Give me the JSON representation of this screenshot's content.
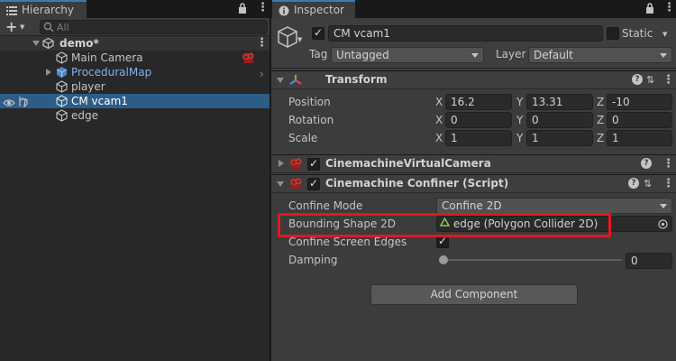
{
  "hierarchy": {
    "tab_label": "Hierarchy",
    "search_placeholder": "All",
    "scene_name": "demo*",
    "items": [
      {
        "label": "Main Camera",
        "type": "object"
      },
      {
        "label": "ProceduralMap",
        "type": "prefab"
      },
      {
        "label": "player",
        "type": "object"
      },
      {
        "label": "CM vcam1",
        "type": "object",
        "selected": true
      },
      {
        "label": "edge",
        "type": "object"
      }
    ]
  },
  "inspector": {
    "tab_label": "Inspector",
    "object": {
      "name": "CM vcam1",
      "active": true,
      "static_label": "Static",
      "tag_label": "Tag",
      "tag_value": "Untagged",
      "layer_label": "Layer",
      "layer_value": "Default"
    },
    "transform": {
      "title": "Transform",
      "rows": [
        {
          "label": "Position",
          "x": "16.2",
          "y": "13.31",
          "z": "-10"
        },
        {
          "label": "Rotation",
          "x": "0",
          "y": "0",
          "z": "0"
        },
        {
          "label": "Scale",
          "x": "1",
          "y": "1",
          "z": "1"
        }
      ],
      "axis_labels": {
        "x": "X",
        "y": "Y",
        "z": "Z"
      }
    },
    "virtual_camera": {
      "title": "CinemachineVirtualCamera",
      "enabled": true
    },
    "confiner": {
      "title": "Cinemachine Confiner (Script)",
      "enabled": true,
      "confine_mode_label": "Confine Mode",
      "confine_mode_value": "Confine 2D",
      "bounding_shape_label": "Bounding Shape 2D",
      "bounding_shape_value": "edge (Polygon Collider 2D)",
      "confine_screen_edges_label": "Confine Screen Edges",
      "confine_screen_edges": true,
      "damping_label": "Damping",
      "damping_value": "0",
      "damping_fraction": 0
    },
    "add_component_label": "Add Component"
  },
  "colors": {
    "selection": "#2c5d87",
    "highlight_box": "#e0191f",
    "prefab_text": "#7fb2ee",
    "tab_accent": "#3a79bb"
  }
}
